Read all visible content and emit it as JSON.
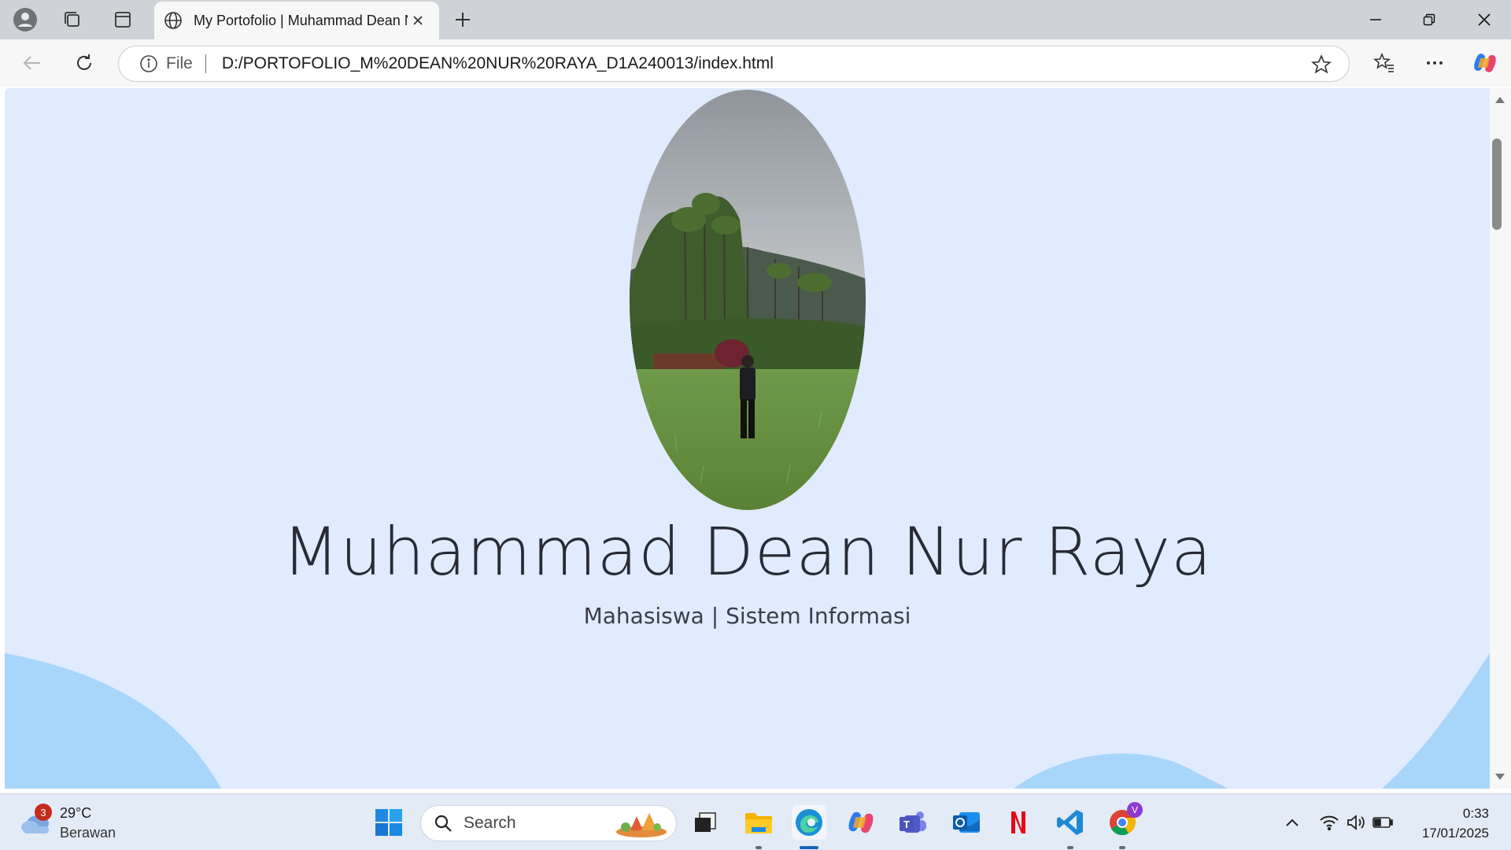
{
  "browser": {
    "tab_title": "My Portofolio | Muhammad Dean Nur Raya",
    "address_scheme_label": "File",
    "url": "D:/PORTOFOLIO_M%20DEAN%20NUR%20RAYA_D1A240013/index.html"
  },
  "page": {
    "name": "Muhammad Dean Nur Raya",
    "subtitle": "Mahasiswa | Sistem Informasi",
    "background_color": "#e0ebfd",
    "wave_color": "#a8d6fb"
  },
  "taskbar": {
    "weather_badge": "3",
    "temperature": "29°C",
    "condition": "Berawan",
    "search_placeholder": "Search",
    "time": "0:33",
    "date": "17/01/2025",
    "chrome_profile_letter": "V"
  }
}
